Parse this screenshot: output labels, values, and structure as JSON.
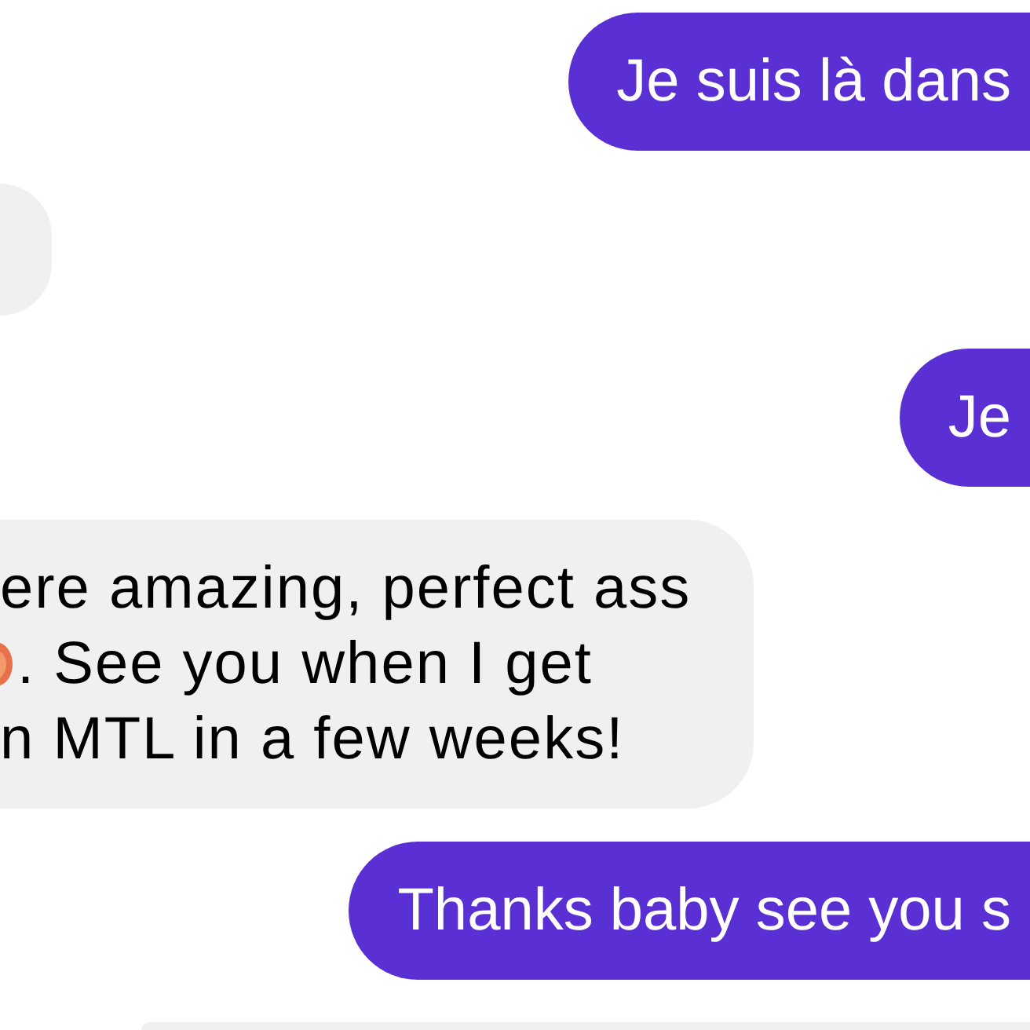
{
  "messages": [
    {
      "kind": "sent",
      "text": "Je suis là dans"
    },
    {
      "kind": "received"
    },
    {
      "kind": "sent",
      "text": "Je"
    },
    {
      "kind": "received",
      "lines": [
        {
          "text": "ere amazing, perfect ass",
          "leading_emoji": false
        },
        {
          "text": ". See you when I get",
          "leading_emoji": true
        },
        {
          "text": "n MTL in a few weeks!",
          "leading_emoji": false
        }
      ]
    },
    {
      "kind": "sent",
      "text": "Thanks baby see you s"
    },
    {
      "kind": "received"
    }
  ]
}
